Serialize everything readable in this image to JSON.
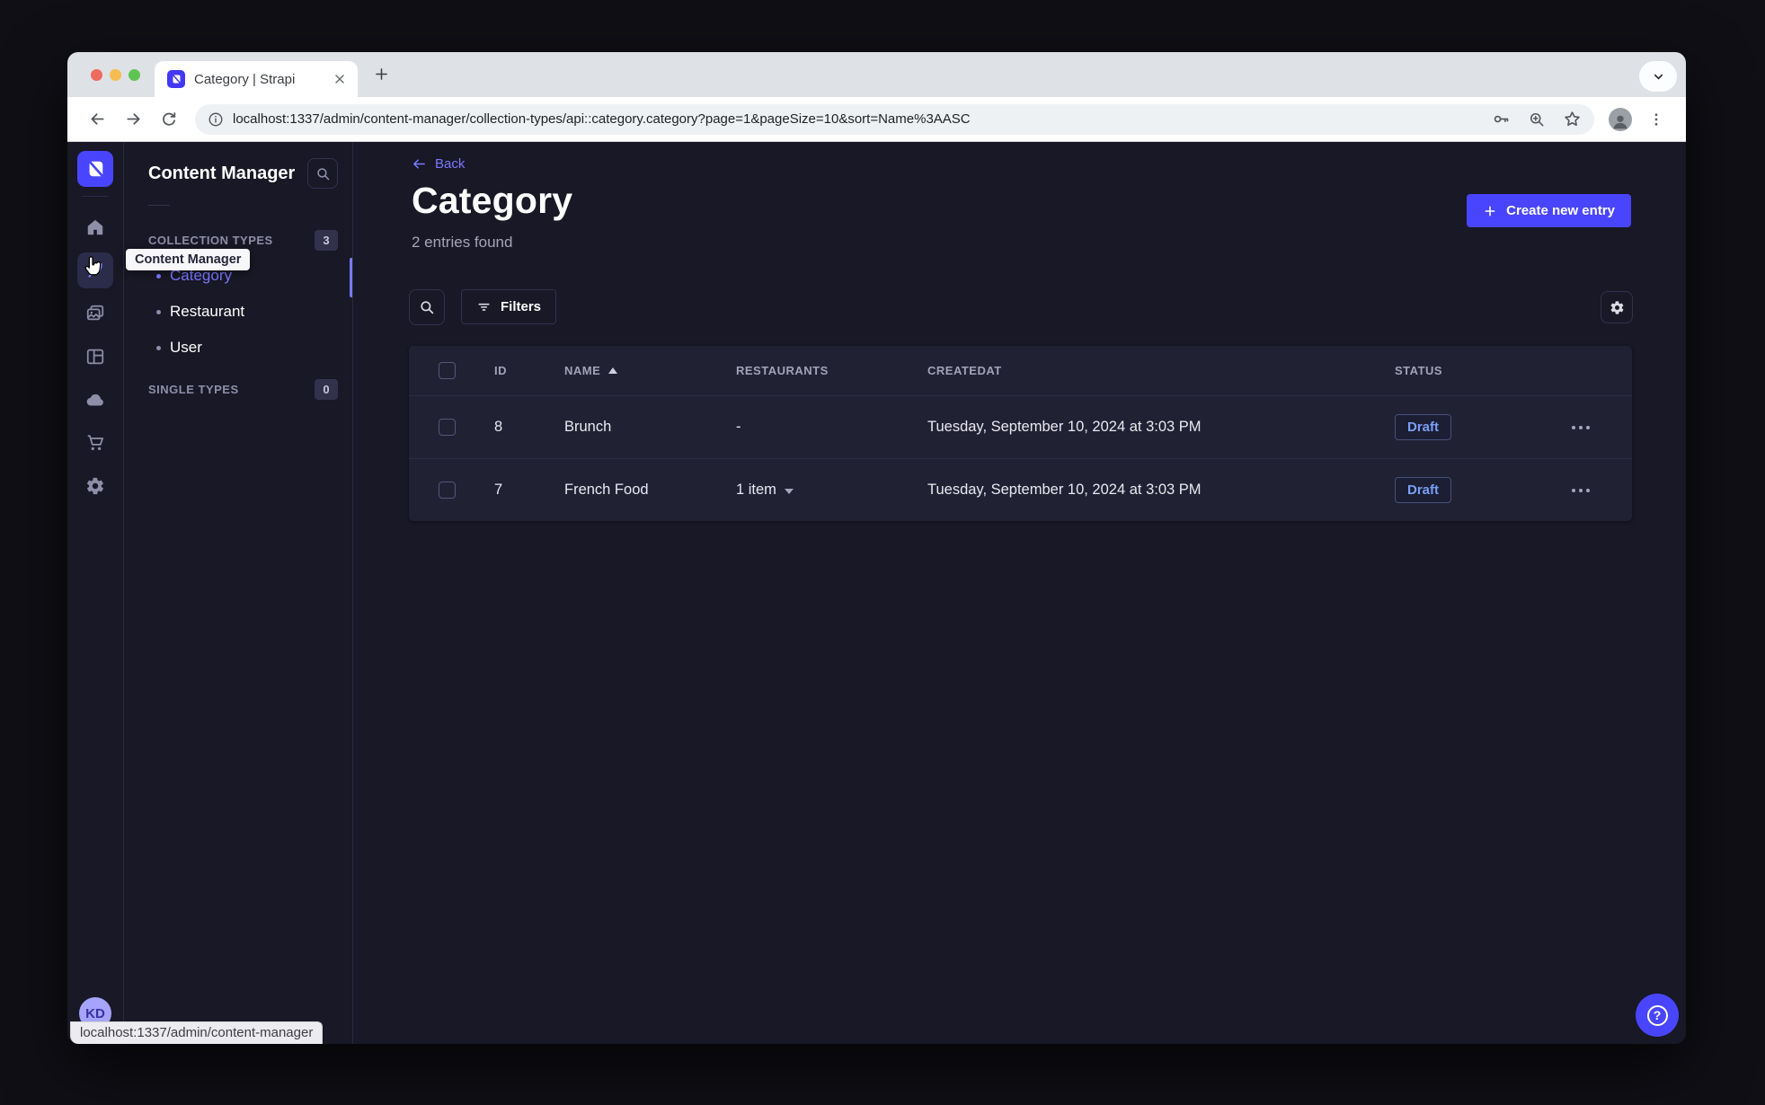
{
  "browser": {
    "tab_title": "Category | Strapi",
    "url": "localhost:1337/admin/content-manager/collection-types/api::category.category?page=1&pageSize=10&sort=Name%3AASC",
    "status_link": "localhost:1337/admin/content-manager"
  },
  "sidebar": {
    "user_initials": "KD"
  },
  "subnav": {
    "title": "Content Manager",
    "tooltip": "Content Manager",
    "collection_types": {
      "label": "COLLECTION TYPES",
      "badge": "3",
      "items": [
        {
          "label": "Category",
          "active": true
        },
        {
          "label": "Restaurant",
          "active": false
        },
        {
          "label": "User",
          "active": false
        }
      ]
    },
    "single_types": {
      "label": "SINGLE TYPES",
      "badge": "0"
    }
  },
  "main": {
    "back_label": "Back",
    "title": "Category",
    "subtitle": "2 entries found",
    "create_button_label": "Create new entry",
    "filters_label": "Filters",
    "table": {
      "headers": {
        "id": "ID",
        "name": "NAME",
        "restaurants": "RESTAURANTS",
        "createdat": "CREATEDAT",
        "status": "STATUS"
      },
      "rows": [
        {
          "id": "8",
          "name": "Brunch",
          "restaurants": "-",
          "createdat": "Tuesday, September 10, 2024 at 3:03 PM",
          "status": "Draft"
        },
        {
          "id": "7",
          "name": "French Food",
          "restaurants": "1 item",
          "createdat": "Tuesday, September 10, 2024 at 3:03 PM",
          "status": "Draft"
        }
      ]
    }
  },
  "icons": {
    "question_mark": "?"
  },
  "colors": {
    "primary": "#4945ff",
    "primary_light": "#7b79ff",
    "app_bg": "#181826",
    "card_bg": "#212134",
    "border": "#32324d",
    "draft_text": "#7b9ff8"
  }
}
